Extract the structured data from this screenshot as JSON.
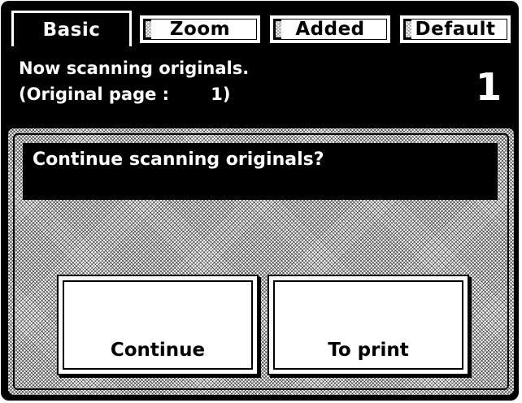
{
  "tabs": [
    {
      "label": "Basic",
      "active": true
    },
    {
      "label": "Zoom",
      "active": false
    },
    {
      "label": "Added",
      "active": false
    },
    {
      "label": "Default",
      "active": false
    }
  ],
  "status": {
    "line1": "Now scanning originals.",
    "line2": "(Original page :       1)",
    "page_count": "1"
  },
  "dialog": {
    "prompt": "Continue scanning originals?",
    "buttons": {
      "continue": "Continue",
      "to_print": "To print"
    }
  },
  "colors": {
    "background": "#000000",
    "foreground": "#ffffff"
  }
}
